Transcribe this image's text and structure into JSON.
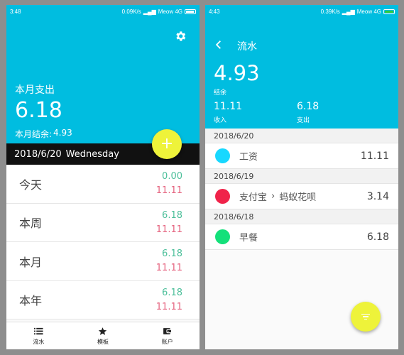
{
  "left": {
    "status": {
      "time": "3:48",
      "speed": "0.09K/s",
      "carrier": "Meow 4G"
    },
    "header": {
      "month_label": "本月支出",
      "month_value": "6.18",
      "balance_label": "本月结余:",
      "balance_value": "4.93"
    },
    "fab_add_symbol": "+",
    "date_bar": {
      "date": "2018/6/20",
      "weekday": "Wednesday"
    },
    "summary": [
      {
        "label": "今天",
        "income": "0.00",
        "expense": "11.11"
      },
      {
        "label": "本周",
        "income": "6.18",
        "expense": "11.11"
      },
      {
        "label": "本月",
        "income": "6.18",
        "expense": "11.11"
      },
      {
        "label": "本年",
        "income": "6.18",
        "expense": "11.11"
      }
    ],
    "nav": [
      {
        "label": "流水",
        "icon": "list-icon"
      },
      {
        "label": "模板",
        "icon": "star-icon"
      },
      {
        "label": "账户",
        "icon": "wallet-icon"
      }
    ]
  },
  "right": {
    "status": {
      "time": "4:43",
      "speed": "0.39K/s",
      "carrier": "Meow 4G"
    },
    "header": {
      "title": "流水",
      "balance": "4.93",
      "balance_label": "结余",
      "income": "11.11",
      "income_label": "收入",
      "expense": "6.18",
      "expense_label": "支出"
    },
    "groups": [
      {
        "date": "2018/6/20",
        "items": [
          {
            "name": "工资",
            "sub": "",
            "amount": "11.11",
            "color": "#18d8ff"
          }
        ]
      },
      {
        "date": "2018/6/19",
        "items": [
          {
            "name": "支付宝",
            "sub": "蚂蚁花呗",
            "amount": "3.14",
            "color": "#f0234a"
          }
        ]
      },
      {
        "date": "2018/6/18",
        "items": [
          {
            "name": "早餐",
            "sub": "",
            "amount": "6.18",
            "color": "#14e07a"
          }
        ]
      }
    ],
    "fab_filter_icon": "filter-icon"
  },
  "colors": {
    "primary": "#00bde0",
    "fab": "#eef33a",
    "income": "#4cbf9a",
    "expense": "#e5637f",
    "date_bar": "#111111"
  }
}
